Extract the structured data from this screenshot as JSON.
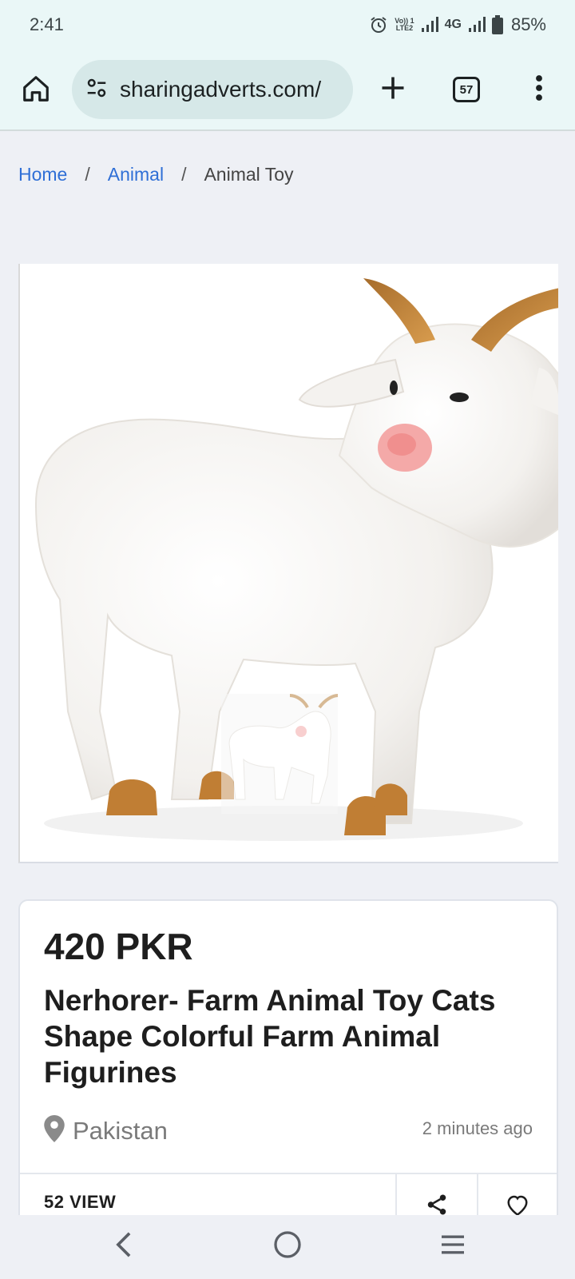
{
  "status_bar": {
    "time": "2:41",
    "volte_line1": "Vo)) 1",
    "volte_line2": "LTE2",
    "network": "4G",
    "battery": "85%",
    "icons": [
      "alarm-icon",
      "volte-icon",
      "signal-icon",
      "signal-icon",
      "battery-icon"
    ]
  },
  "browser": {
    "url": "sharingadverts.com/",
    "tab_count": "57",
    "icons": [
      "home-icon",
      "site-settings-icon",
      "plus-icon",
      "tab-switcher-icon",
      "more-vert-icon"
    ],
    "accent_color": "#eaf7f7"
  },
  "breadcrumb": {
    "items": [
      "Home",
      "Animal",
      "Animal Toy"
    ],
    "separator": "/",
    "link_color": "#2f6fd6"
  },
  "listing": {
    "image_alt": "white goat figurine",
    "price": "420 PKR",
    "title": "Nerhorer- Farm Animal Toy Cats Shape Colorful Farm Animal Figurines",
    "location": "Pakistan",
    "posted": "2 minutes ago",
    "views": "52 VIEW",
    "icons": [
      "location-pin-icon",
      "share-icon",
      "heart-icon"
    ]
  },
  "nav_bar": {
    "icons": [
      "back-icon",
      "home-circle-icon",
      "recents-icon"
    ]
  }
}
